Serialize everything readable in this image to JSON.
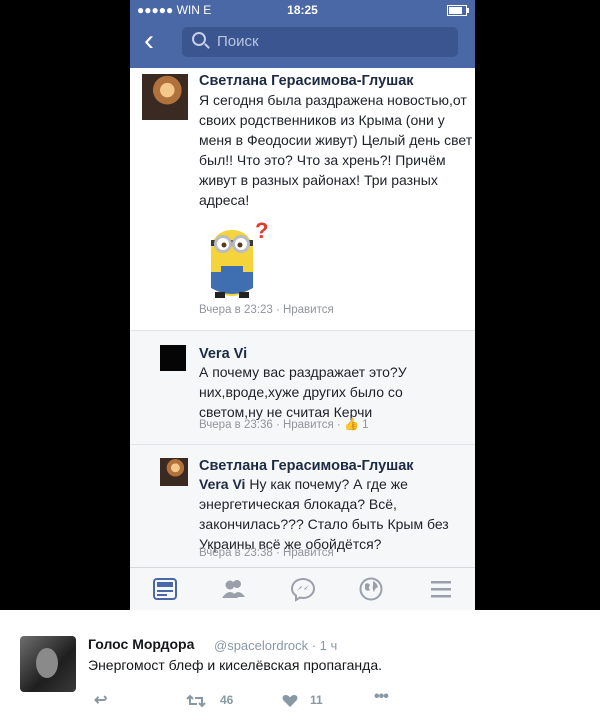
{
  "status": {
    "carrier": "●●●●● WIN  E",
    "time": "18:25"
  },
  "navbar": {
    "back": "‹",
    "search_placeholder": "Поиск"
  },
  "comments": [
    {
      "author": "Светлана Герасимова-Глушак",
      "text": "Я сегодня была раздражена новостью,от своих родственников из Крыма (они у меня в Феодосии живут) Целый день свет был!! Что это? Что за хрень?! Причём живут в разных районах! Три разных адреса!",
      "meta": "Вчера в 23:23 · Нравится"
    },
    {
      "author": "Vera Vi",
      "text": "А почему вас раздражает это?У них,вроде,хуже других было со светом,ну не считая Керчи",
      "meta": "Вчера в 23:36 · Нравится ·",
      "likes": "1"
    },
    {
      "author": "Светлана Герасимова-Глушак",
      "mention": "Vera Vi",
      "text": " Ну как почему? А где же энергетическая блокада? Всё, закончилась??? Стало быть Крым без Украины всё же обойдётся?",
      "meta": "Вчера в 23:38 · Нравится"
    }
  ],
  "tabbar": [
    "news-feed-icon",
    "friends-icon",
    "messenger-icon",
    "globe-icon",
    "menu-icon"
  ],
  "tweet": {
    "name": "Голос Мордора",
    "handle": "@spacelordrock · 1 ч",
    "text": "Энергомост блеф и киселёвская пропаганда.",
    "retweets": "46",
    "likes": "11"
  },
  "colors": {
    "fb_blue": "#4a67a6",
    "tab_active": "#4a67a6",
    "tab_inactive": "#9aa0ab"
  }
}
